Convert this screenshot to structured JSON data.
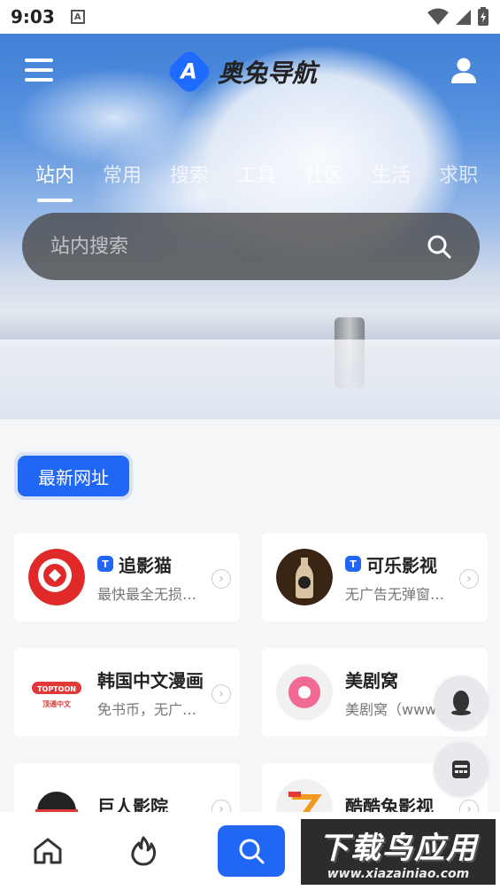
{
  "status_bar": {
    "time": "9:03",
    "badge": "A"
  },
  "header": {
    "app_name": "奥兔导航",
    "logo_letter": "A"
  },
  "tabs": [
    {
      "label": "站内"
    },
    {
      "label": "常用"
    },
    {
      "label": "搜索"
    },
    {
      "label": "工具"
    },
    {
      "label": "社区"
    },
    {
      "label": "生活"
    },
    {
      "label": "求职"
    }
  ],
  "search": {
    "placeholder": "站内搜索"
  },
  "section": {
    "label": "最新网址"
  },
  "cards": [
    {
      "title": "追影猫",
      "desc": "最快最全无损…",
      "tag": "T"
    },
    {
      "title": "可乐影视",
      "desc": "无广告无弹窗…",
      "tag": "T"
    },
    {
      "title": "韩国中文漫画",
      "desc": "免书币，无广…",
      "icon_text_top": "TOPTOON",
      "icon_text_bottom": "顶通中文"
    },
    {
      "title": "美剧窝",
      "desc": "美剧窝（www.…"
    },
    {
      "title": "巨人影院",
      "desc": ""
    },
    {
      "title": "酷酷兔影视",
      "desc": ""
    }
  ],
  "watermark": {
    "main": "下载鸟应用",
    "url": "www.xiazainiao.com"
  },
  "colors": {
    "accent": "#2067f5",
    "background": "#f5f6f8"
  }
}
